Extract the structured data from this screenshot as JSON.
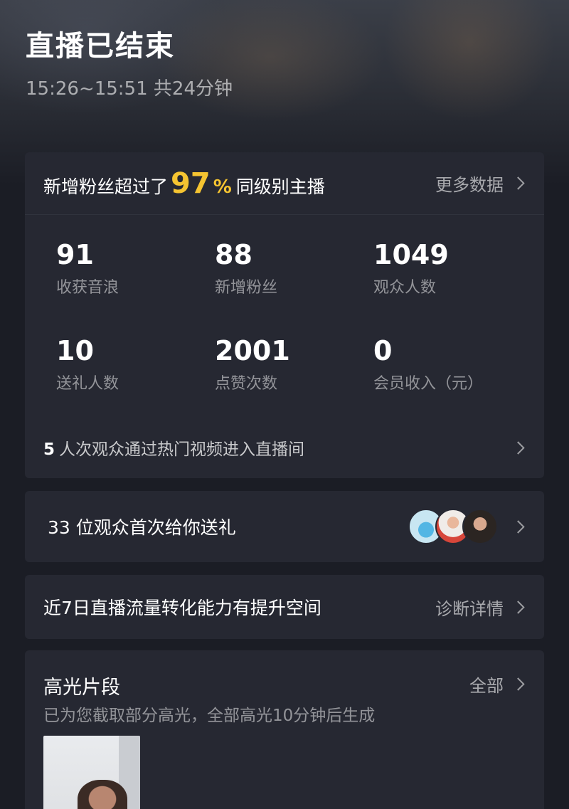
{
  "header": {
    "title": "直播已结束",
    "time_range": "15:26~15:51 共24分钟"
  },
  "stats_card": {
    "headline_prefix": "新增粉丝超过了",
    "headline_percent": "97",
    "headline_percent_sign": "%",
    "headline_suffix": "同级别主播",
    "more_link": "更多数据",
    "metrics": [
      {
        "value": "91",
        "label": "收获音浪"
      },
      {
        "value": "88",
        "label": "新增粉丝"
      },
      {
        "value": "1049",
        "label": "观众人数"
      },
      {
        "value": "10",
        "label": "送礼人数"
      },
      {
        "value": "2001",
        "label": "点赞次数"
      },
      {
        "value": "0",
        "label": "会员收入（元）"
      }
    ],
    "hot_video_count": "5",
    "hot_video_text": "人次观众通过热门视频进入直播间"
  },
  "gifts_card": {
    "text": "33 位观众首次给你送礼",
    "avatars": [
      "avatar-1",
      "avatar-2",
      "avatar-3"
    ]
  },
  "traffic_card": {
    "text": "近7日直播流量转化能力有提升空间",
    "link": "诊断详情"
  },
  "highlights_card": {
    "title": "高光片段",
    "link": "全部",
    "subtitle": "已为您截取部分高光，全部高光10分钟后生成"
  },
  "colors": {
    "accent": "#f5c431",
    "card_bg": "#262832",
    "page_bg": "#1b1d25"
  },
  "icons": {
    "chevron": "chevron-right-icon"
  }
}
